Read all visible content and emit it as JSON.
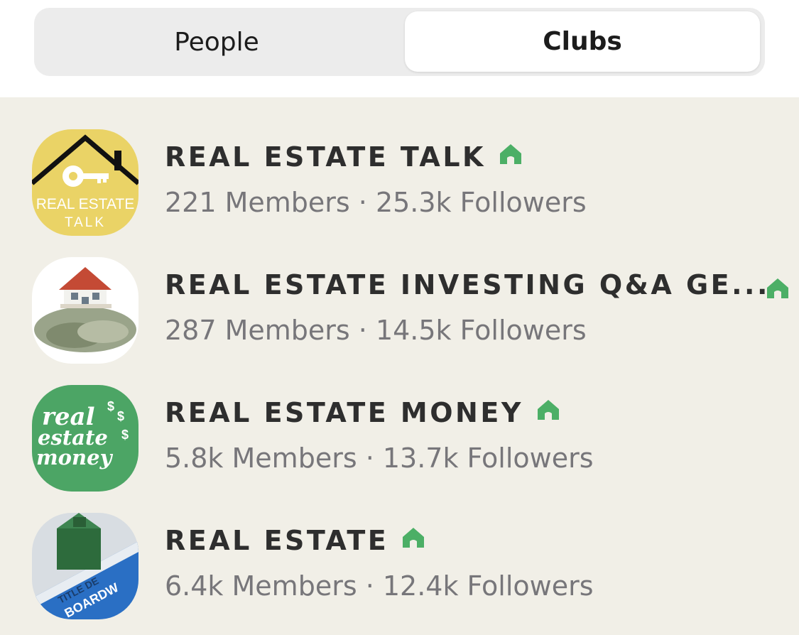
{
  "tabs": {
    "people": "People",
    "clubs": "Clubs",
    "active": "Clubs"
  },
  "accent_green": "#4caf66",
  "clubs": [
    {
      "name": "REAL ESTATE TALK",
      "stats": "221 Members · 25.3k Followers",
      "avatar_text_1": "REAL ESTATE",
      "avatar_text_2": "TALK",
      "badge_icon": "home-icon"
    },
    {
      "name": "REAL ESTATE INVESTING Q&A GE...",
      "stats": "287 Members · 14.5k Followers",
      "badge_icon": "home-icon"
    },
    {
      "name": "REAL ESTATE MONEY",
      "stats": "5.8k Members · 13.7k Followers",
      "avatar_text_1": "real",
      "avatar_text_2": "estate",
      "avatar_text_3": "money",
      "badge_icon": "home-icon"
    },
    {
      "name": "REAL ESTATE",
      "stats": "6.4k Members · 12.4k Followers",
      "avatar_text_1": "TITLE DE",
      "avatar_text_2": "BOARDW",
      "badge_icon": "home-icon"
    }
  ]
}
